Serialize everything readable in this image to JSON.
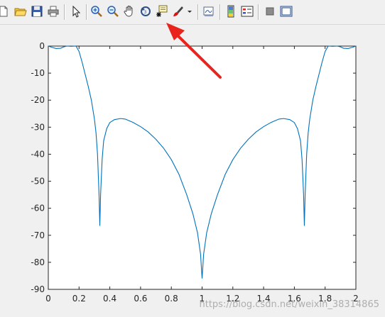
{
  "toolbar": {
    "buttons": [
      {
        "name": "new-figure-icon"
      },
      {
        "name": "open-file-icon"
      },
      {
        "name": "save-figure-icon"
      },
      {
        "name": "print-figure-icon"
      },
      {
        "name": "edit-plot-arrow-icon"
      },
      {
        "name": "zoom-in-icon"
      },
      {
        "name": "zoom-out-icon"
      },
      {
        "name": "pan-hand-icon"
      },
      {
        "name": "rotate-3d-icon"
      },
      {
        "name": "data-cursor-icon"
      },
      {
        "name": "brush-icon"
      },
      {
        "name": "link-plot-icon"
      },
      {
        "name": "insert-colorbar-icon"
      },
      {
        "name": "insert-legend-icon"
      },
      {
        "name": "hide-plot-tools-icon"
      },
      {
        "name": "show-plot-tools-icon"
      }
    ]
  },
  "annotation": {
    "arrow_color": "#e8241c",
    "target": "data-cursor-icon"
  },
  "watermark": "https://blog.csdn.net/weixin_38314865",
  "chart_data": {
    "type": "line",
    "title": "",
    "xlabel": "",
    "ylabel": "",
    "xlim": [
      0,
      2
    ],
    "ylim": [
      -90,
      0
    ],
    "xticks": [
      "0",
      "0.2",
      "0.4",
      "0.6",
      "0.8",
      "1",
      "1.2",
      "1.4",
      "1.6",
      "1.8",
      "2"
    ],
    "yticks": [
      "0",
      "-10",
      "-20",
      "-30",
      "-40",
      "-50",
      "-60",
      "-70",
      "-80",
      "-90"
    ],
    "line_color": "#0072bd",
    "grid": false,
    "series": [
      {
        "x": [
          0,
          0.02,
          0.05,
          0.08,
          0.1,
          0.12,
          0.15,
          0.18,
          0.2,
          0.22,
          0.24,
          0.26,
          0.28,
          0.3,
          0.31,
          0.32,
          0.33,
          0.335,
          0.34,
          0.35,
          0.36,
          0.38,
          0.4,
          0.43,
          0.47,
          0.5,
          0.55,
          0.6,
          0.65,
          0.7,
          0.75,
          0.8,
          0.85,
          0.9,
          0.94,
          0.97,
          0.99,
          1.0,
          1.01,
          1.03,
          1.06,
          1.1,
          1.15,
          1.2,
          1.25,
          1.3,
          1.35,
          1.4,
          1.45,
          1.5,
          1.53,
          1.57,
          1.6,
          1.62,
          1.64,
          1.65,
          1.66,
          1.665,
          1.67,
          1.68,
          1.69,
          1.7,
          1.72,
          1.74,
          1.76,
          1.78,
          1.8,
          1.82,
          1.85,
          1.88,
          1.9,
          1.92,
          1.95,
          1.98,
          2.0
        ],
        "y": [
          0,
          -0.4,
          -0.9,
          -0.8,
          -0.3,
          0,
          -0.1,
          0,
          -2,
          -6,
          -10.5,
          -15,
          -20,
          -27,
          -32,
          -40,
          -55,
          -66.5,
          -55,
          -42,
          -35,
          -30.5,
          -28.3,
          -27.2,
          -26.8,
          -27,
          -28.2,
          -29.8,
          -31.8,
          -34.5,
          -37.8,
          -42,
          -47.5,
          -55,
          -62,
          -69,
          -77,
          -86,
          -77,
          -69,
          -62,
          -55,
          -47.5,
          -42,
          -37.8,
          -34.5,
          -31.8,
          -29.8,
          -28.2,
          -27,
          -26.8,
          -27.2,
          -28.3,
          -30.5,
          -35,
          -42,
          -55,
          -66.5,
          -55,
          -40,
          -32,
          -27,
          -20,
          -15,
          -10.5,
          -6,
          -2,
          0,
          -0.1,
          0,
          -0.3,
          -0.8,
          -0.9,
          -0.4,
          0
        ]
      }
    ]
  }
}
